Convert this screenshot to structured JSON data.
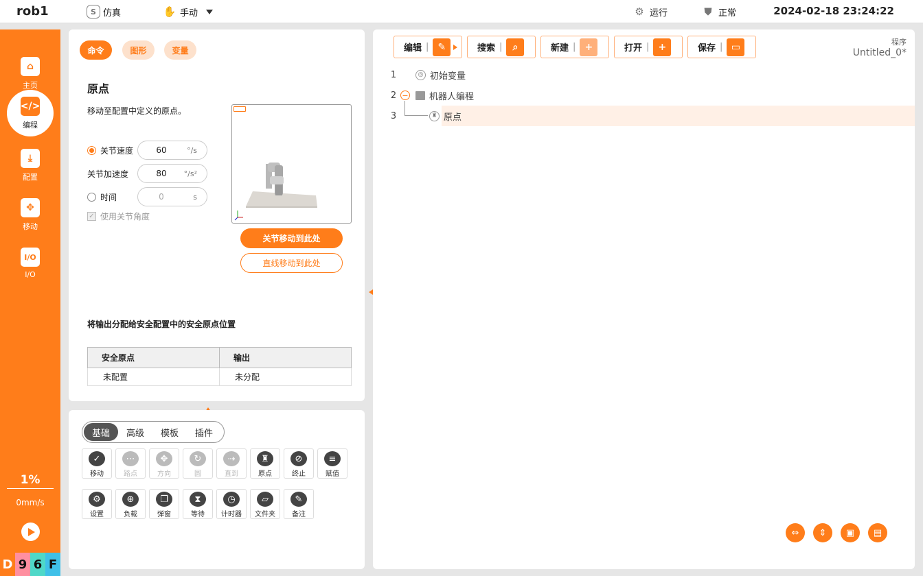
{
  "topbar": {
    "robot_name": "rob1",
    "sim_label": "仿真",
    "mode_label": "手动",
    "run_label": "运行",
    "status_label": "正常",
    "datetime": "2024-02-18 23:24:22"
  },
  "sidebar": {
    "items": [
      {
        "label": "主页",
        "icon": "home-icon"
      },
      {
        "label": "编程",
        "icon": "code-icon"
      },
      {
        "label": "配置",
        "icon": "download-icon"
      },
      {
        "label": "移动",
        "icon": "move-icon"
      },
      {
        "label": "I/O",
        "icon": "io-icon"
      }
    ],
    "speed_percent": "1%",
    "speed_mm": "0mm/s",
    "hex": [
      "D",
      "9",
      "6",
      "F"
    ]
  },
  "command_panel": {
    "tabs": [
      "命令",
      "图形",
      "变量"
    ],
    "title": "原点",
    "description": "移动至配置中定义的原点。",
    "joint_speed_label": "关节速度",
    "joint_speed_value": "60",
    "joint_speed_unit": "°/s",
    "joint_acc_label": "关节加速度",
    "joint_acc_value": "80",
    "joint_acc_unit": "°/s²",
    "time_label": "时间",
    "time_value": "0",
    "time_unit": "s",
    "use_joint_angle_label": "使用关节角度",
    "move_joint_button": "关节移动到此处",
    "move_linear_button": "直线移动到此处",
    "output_desc": "将输出分配给安全配置中的安全原点位置",
    "table": {
      "headers": [
        "安全原点",
        "输出"
      ],
      "rows": [
        [
          "未配置",
          "未分配"
        ]
      ]
    }
  },
  "tool_panel": {
    "tabs": [
      "基础",
      "高级",
      "模板",
      "插件"
    ],
    "row1": [
      {
        "label": "移动",
        "enabled": true
      },
      {
        "label": "路点",
        "enabled": false
      },
      {
        "label": "方向",
        "enabled": false
      },
      {
        "label": "圆",
        "enabled": false
      },
      {
        "label": "直到",
        "enabled": false
      },
      {
        "label": "原点",
        "enabled": true
      },
      {
        "label": "终止",
        "enabled": true
      },
      {
        "label": "赋值",
        "enabled": true
      }
    ],
    "row2": [
      {
        "label": "设置",
        "enabled": true
      },
      {
        "label": "负载",
        "enabled": true
      },
      {
        "label": "弹窗",
        "enabled": true
      },
      {
        "label": "等待",
        "enabled": true
      },
      {
        "label": "计时器",
        "enabled": true
      },
      {
        "label": "文件夹",
        "enabled": true
      },
      {
        "label": "备注",
        "enabled": true
      }
    ]
  },
  "program_panel": {
    "toolbar": [
      "编辑",
      "搜索",
      "新建",
      "打开",
      "保存"
    ],
    "program_label": "程序",
    "program_name": "Untitled_0*",
    "lines": [
      {
        "no": "1",
        "text": "初始变量"
      },
      {
        "no": "2",
        "text": "机器人编程"
      },
      {
        "no": "3",
        "text": "原点"
      }
    ]
  },
  "colors": {
    "accent": "#ff7d1a",
    "selected_line": "#fff0e6"
  }
}
